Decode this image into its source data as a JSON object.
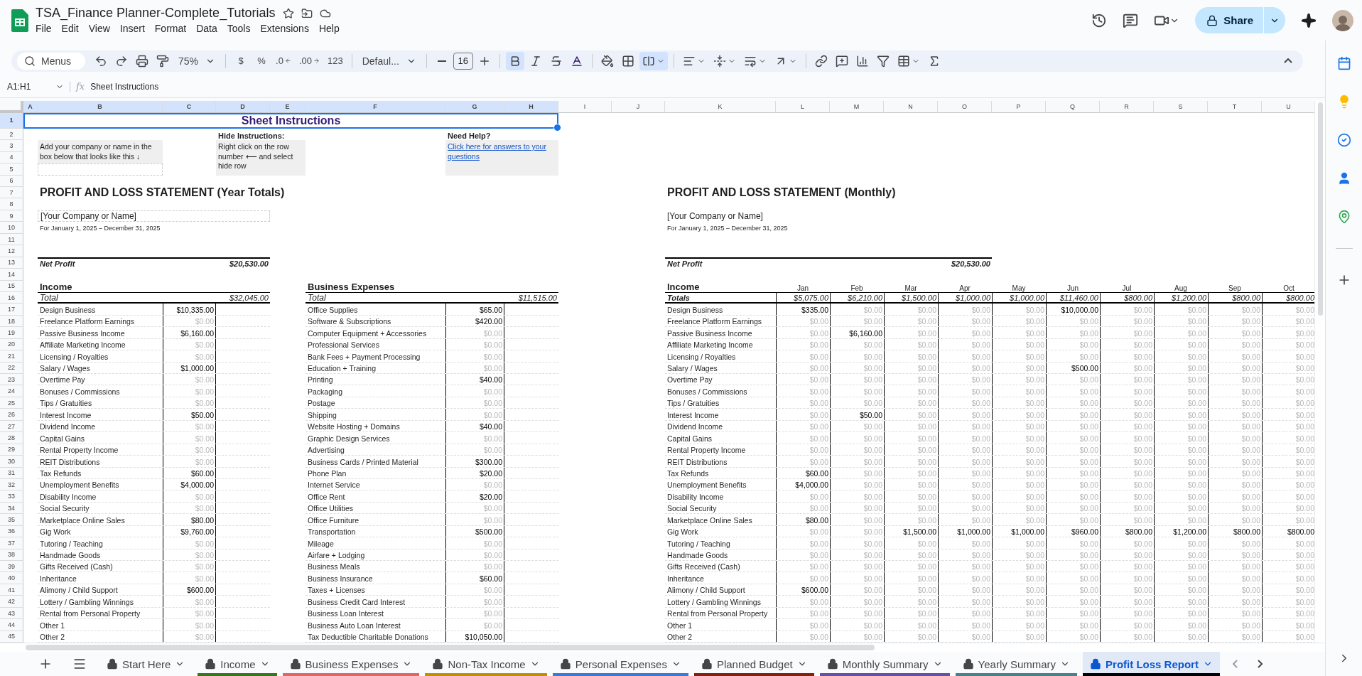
{
  "app": {
    "title": "TSA_Finance Planner-Complete_Tutorials",
    "menus": [
      "File",
      "Edit",
      "View",
      "Insert",
      "Format",
      "Data",
      "Tools",
      "Extensions",
      "Help"
    ],
    "share": "Share"
  },
  "toolbar": {
    "search_placeholder": "Menus",
    "zoom": "75%",
    "currency": "$",
    "percent": "%",
    "decrease_decimals": ".0",
    "increase_decimals": ".00",
    "number_format": "123",
    "font": "Defaul...",
    "font_size": "16",
    "bold": true,
    "merge": true
  },
  "formula_bar": {
    "cell": "A1:H1",
    "fx": "fx",
    "content": "Sheet Instructions"
  },
  "column_headers": [
    {
      "label": "A",
      "selected": true
    },
    {
      "label": "B",
      "selected": true
    },
    {
      "label": "C",
      "selected": true
    },
    {
      "label": "D",
      "selected": true
    },
    {
      "label": "E",
      "selected": true
    },
    {
      "label": "F",
      "selected": true
    },
    {
      "label": "G",
      "selected": true
    },
    {
      "label": "H",
      "selected": true
    },
    {
      "label": "I",
      "selected": false
    },
    {
      "label": "J",
      "selected": false
    },
    {
      "label": "K",
      "selected": false
    },
    {
      "label": "L",
      "selected": false
    },
    {
      "label": "M",
      "selected": false
    },
    {
      "label": "N",
      "selected": false
    },
    {
      "label": "O",
      "selected": false
    },
    {
      "label": "P",
      "selected": false
    },
    {
      "label": "Q",
      "selected": false
    },
    {
      "label": "R",
      "selected": false
    },
    {
      "label": "S",
      "selected": false
    },
    {
      "label": "T",
      "selected": false
    },
    {
      "label": "U",
      "selected": false
    }
  ],
  "row_headers": [
    {
      "label": "1",
      "selected": true
    },
    {
      "label": "2",
      "selected": false
    },
    {
      "label": "3",
      "selected": false
    },
    {
      "label": "4",
      "selected": false
    },
    {
      "label": "5",
      "selected": false
    },
    {
      "label": "6",
      "selected": false
    },
    {
      "label": "7",
      "selected": false
    },
    {
      "label": "8",
      "selected": false
    },
    {
      "label": "9",
      "selected": false
    },
    {
      "label": "10",
      "selected": false
    },
    {
      "label": "11",
      "selected": false
    },
    {
      "label": "12",
      "selected": false
    },
    {
      "label": "13",
      "selected": false
    },
    {
      "label": "14",
      "selected": false
    },
    {
      "label": "15",
      "selected": false
    },
    {
      "label": "16",
      "selected": false
    },
    {
      "label": "17",
      "selected": false
    },
    {
      "label": "18",
      "selected": false
    },
    {
      "label": "19",
      "selected": false
    },
    {
      "label": "20",
      "selected": false
    },
    {
      "label": "21",
      "selected": false
    },
    {
      "label": "22",
      "selected": false
    },
    {
      "label": "23",
      "selected": false
    },
    {
      "label": "24",
      "selected": false
    },
    {
      "label": "25",
      "selected": false
    },
    {
      "label": "26",
      "selected": false
    },
    {
      "label": "27",
      "selected": false
    },
    {
      "label": "28",
      "selected": false
    },
    {
      "label": "29",
      "selected": false
    },
    {
      "label": "30",
      "selected": false
    },
    {
      "label": "31",
      "selected": false
    },
    {
      "label": "32",
      "selected": false
    },
    {
      "label": "33",
      "selected": false
    },
    {
      "label": "34",
      "selected": false
    },
    {
      "label": "35",
      "selected": false
    },
    {
      "label": "36",
      "selected": false
    },
    {
      "label": "37",
      "selected": false
    },
    {
      "label": "38",
      "selected": false
    },
    {
      "label": "39",
      "selected": false
    },
    {
      "label": "40",
      "selected": false
    },
    {
      "label": "41",
      "selected": false
    },
    {
      "label": "42",
      "selected": false
    },
    {
      "label": "43",
      "selected": false
    },
    {
      "label": "44",
      "selected": false
    },
    {
      "label": "45",
      "selected": false
    }
  ],
  "instructions": {
    "title": "Sheet Instructions",
    "hide_heading": "Hide Instructions:",
    "help_heading": "Need Help?",
    "company_hint": "Add your company or name in the box below that looks like this ↓",
    "hide_text": "Right click on the row number ⟵ and select hide row",
    "help_link": "Click here for answers to your questions"
  },
  "year_totals": {
    "title": "PROFIT AND LOSS STATEMENT (Year Totals)",
    "company": "[Your Company or Name]",
    "period": "For January 1, 2025 – December 31, 2025",
    "net_profit_label": "Net Profit",
    "net_profit": "$20,530.00",
    "income": {
      "heading": "Income",
      "total_label": "Total",
      "total": "$32,045.00",
      "rows": [
        {
          "label": "Design Business",
          "value": "$10,335.00",
          "dim": false
        },
        {
          "label": "Freelance Platform Earnings",
          "value": "$0.00",
          "dim": true
        },
        {
          "label": "Passive Business Income",
          "value": "$6,160.00",
          "dim": false
        },
        {
          "label": "Affiliate Marketing Income",
          "value": "$0.00",
          "dim": true
        },
        {
          "label": "Licensing / Royalties",
          "value": "$0.00",
          "dim": true
        },
        {
          "label": "Salary / Wages",
          "value": "$1,000.00",
          "dim": false
        },
        {
          "label": "Overtime Pay",
          "value": "$0.00",
          "dim": true
        },
        {
          "label": "Bonuses / Commissions",
          "value": "$0.00",
          "dim": true
        },
        {
          "label": "Tips / Gratuities",
          "value": "$0.00",
          "dim": true
        },
        {
          "label": "Interest Income",
          "value": "$50.00",
          "dim": false
        },
        {
          "label": "Dividend Income",
          "value": "$0.00",
          "dim": true
        },
        {
          "label": "Capital Gains",
          "value": "$0.00",
          "dim": true
        },
        {
          "label": "Rental Property Income",
          "value": "$0.00",
          "dim": true
        },
        {
          "label": "REIT Distributions",
          "value": "$0.00",
          "dim": true
        },
        {
          "label": "Tax Refunds",
          "value": "$60.00",
          "dim": false
        },
        {
          "label": "Unemployment Benefits",
          "value": "$4,000.00",
          "dim": false
        },
        {
          "label": "Disability Income",
          "value": "$0.00",
          "dim": true
        },
        {
          "label": "Social Security",
          "value": "$0.00",
          "dim": true
        },
        {
          "label": "Marketplace Online Sales",
          "value": "$80.00",
          "dim": false
        },
        {
          "label": "Gig Work",
          "value": "$9,760.00",
          "dim": false
        },
        {
          "label": "Tutoring / Teaching",
          "value": "$0.00",
          "dim": true
        },
        {
          "label": "Handmade Goods",
          "value": "$0.00",
          "dim": true
        },
        {
          "label": "Gifts Received (Cash)",
          "value": "$0.00",
          "dim": true
        },
        {
          "label": "Inheritance",
          "value": "$0.00",
          "dim": true
        },
        {
          "label": "Alimony / Child Support",
          "value": "$600.00",
          "dim": false
        },
        {
          "label": "Lottery / Gambling Winnings",
          "value": "$0.00",
          "dim": true
        },
        {
          "label": "Rental from Personal Property",
          "value": "$0.00",
          "dim": true
        },
        {
          "label": "Other 1",
          "value": "$0.00",
          "dim": true
        },
        {
          "label": "Other 2",
          "value": "$0.00",
          "dim": true
        }
      ]
    },
    "expenses": {
      "heading": "Business Expenses",
      "total_label": "Total",
      "total": "$11,515.00",
      "rows": [
        {
          "label": "Office Supplies",
          "value": "$65.00",
          "dim": false
        },
        {
          "label": "Software & Subscriptions",
          "value": "$420.00",
          "dim": false
        },
        {
          "label": "Computer Equipment + Accessories",
          "value": "$0.00",
          "dim": true
        },
        {
          "label": "Professional Services",
          "value": "$0.00",
          "dim": true
        },
        {
          "label": "Bank Fees + Payment Processing",
          "value": "$0.00",
          "dim": true
        },
        {
          "label": "Education + Training",
          "value": "$0.00",
          "dim": true
        },
        {
          "label": "Printing",
          "value": "$40.00",
          "dim": false
        },
        {
          "label": "Packaging",
          "value": "$0.00",
          "dim": true
        },
        {
          "label": "Postage",
          "value": "$0.00",
          "dim": true
        },
        {
          "label": "Shipping",
          "value": "$0.00",
          "dim": true
        },
        {
          "label": "Website Hosting + Domains",
          "value": "$40.00",
          "dim": false
        },
        {
          "label": "Graphic Design Services",
          "value": "$0.00",
          "dim": true
        },
        {
          "label": "Advertising",
          "value": "$0.00",
          "dim": true
        },
        {
          "label": "Business Cards / Printed Material",
          "value": "$300.00",
          "dim": false
        },
        {
          "label": "Phone Plan",
          "value": "$20.00",
          "dim": false
        },
        {
          "label": "Internet Service",
          "value": "$0.00",
          "dim": true
        },
        {
          "label": "Office Rent",
          "value": "$20.00",
          "dim": false
        },
        {
          "label": "Office Utilities",
          "value": "$0.00",
          "dim": true
        },
        {
          "label": "Office Furniture",
          "value": "$0.00",
          "dim": true
        },
        {
          "label": "Transportation",
          "value": "$500.00",
          "dim": false
        },
        {
          "label": "Mileage",
          "value": "$0.00",
          "dim": true
        },
        {
          "label": "Airfare + Lodging",
          "value": "$0.00",
          "dim": true
        },
        {
          "label": "Business Meals",
          "value": "$0.00",
          "dim": true
        },
        {
          "label": "Business Insurance",
          "value": "$60.00",
          "dim": false
        },
        {
          "label": "Taxes + Licenses",
          "value": "$0.00",
          "dim": true
        },
        {
          "label": "Business Credit Card Interest",
          "value": "$0.00",
          "dim": true
        },
        {
          "label": "Business Loan Interest",
          "value": "$0.00",
          "dim": true
        },
        {
          "label": "Business Auto Loan Interest",
          "value": "$0.00",
          "dim": true
        },
        {
          "label": "Tax Deductible Charitable Donations",
          "value": "$10,050.00",
          "dim": false
        }
      ]
    }
  },
  "monthly": {
    "title": "PROFIT AND LOSS STATEMENT (Monthly)",
    "company": "[Your Company or Name]",
    "period": "For January 1, 2025 – December 31, 2025",
    "net_profit_label": "Net Profit",
    "net_profit": "$20,530.00",
    "heading": "Income",
    "months": [
      "Jan",
      "Feb",
      "Mar",
      "Apr",
      "May",
      "Jun",
      "Jul",
      "Aug",
      "Sep",
      "Oct"
    ],
    "totals_label": "Totals",
    "totals": [
      "$5,075.00",
      "$6,210.00",
      "$1,500.00",
      "$1,000.00",
      "$1,000.00",
      "$11,460.00",
      "$800.00",
      "$1,200.00",
      "$800.00",
      "$800.00"
    ],
    "rows": [
      {
        "label": "Design Business",
        "values": [
          "$335.00",
          "$0.00",
          "$0.00",
          "$0.00",
          "$0.00",
          "$10,000.00",
          "$0.00",
          "$0.00",
          "$0.00",
          "$0.00"
        ],
        "dim": [
          false,
          true,
          true,
          true,
          true,
          false,
          true,
          true,
          true,
          true
        ]
      },
      {
        "label": "Freelance Platform Earnings",
        "values": [
          "$0.00",
          "$0.00",
          "$0.00",
          "$0.00",
          "$0.00",
          "$0.00",
          "$0.00",
          "$0.00",
          "$0.00",
          "$0.00"
        ],
        "dim": [
          true,
          true,
          true,
          true,
          true,
          true,
          true,
          true,
          true,
          true
        ]
      },
      {
        "label": "Passive Business Income",
        "values": [
          "$0.00",
          "$6,160.00",
          "$0.00",
          "$0.00",
          "$0.00",
          "$0.00",
          "$0.00",
          "$0.00",
          "$0.00",
          "$0.00"
        ],
        "dim": [
          true,
          false,
          true,
          true,
          true,
          true,
          true,
          true,
          true,
          true
        ]
      },
      {
        "label": "Affiliate Marketing Income",
        "values": [
          "$0.00",
          "$0.00",
          "$0.00",
          "$0.00",
          "$0.00",
          "$0.00",
          "$0.00",
          "$0.00",
          "$0.00",
          "$0.00"
        ],
        "dim": [
          true,
          true,
          true,
          true,
          true,
          true,
          true,
          true,
          true,
          true
        ]
      },
      {
        "label": "Licensing / Royalties",
        "values": [
          "$0.00",
          "$0.00",
          "$0.00",
          "$0.00",
          "$0.00",
          "$0.00",
          "$0.00",
          "$0.00",
          "$0.00",
          "$0.00"
        ],
        "dim": [
          true,
          true,
          true,
          true,
          true,
          true,
          true,
          true,
          true,
          true
        ]
      },
      {
        "label": "Salary / Wages",
        "values": [
          "$0.00",
          "$0.00",
          "$0.00",
          "$0.00",
          "$0.00",
          "$500.00",
          "$0.00",
          "$0.00",
          "$0.00",
          "$0.00"
        ],
        "dim": [
          true,
          true,
          true,
          true,
          true,
          false,
          true,
          true,
          true,
          true
        ]
      },
      {
        "label": "Overtime Pay",
        "values": [
          "$0.00",
          "$0.00",
          "$0.00",
          "$0.00",
          "$0.00",
          "$0.00",
          "$0.00",
          "$0.00",
          "$0.00",
          "$0.00"
        ],
        "dim": [
          true,
          true,
          true,
          true,
          true,
          true,
          true,
          true,
          true,
          true
        ]
      },
      {
        "label": "Bonuses / Commissions",
        "values": [
          "$0.00",
          "$0.00",
          "$0.00",
          "$0.00",
          "$0.00",
          "$0.00",
          "$0.00",
          "$0.00",
          "$0.00",
          "$0.00"
        ],
        "dim": [
          true,
          true,
          true,
          true,
          true,
          true,
          true,
          true,
          true,
          true
        ]
      },
      {
        "label": "Tips / Gratuities",
        "values": [
          "$0.00",
          "$0.00",
          "$0.00",
          "$0.00",
          "$0.00",
          "$0.00",
          "$0.00",
          "$0.00",
          "$0.00",
          "$0.00"
        ],
        "dim": [
          true,
          true,
          true,
          true,
          true,
          true,
          true,
          true,
          true,
          true
        ]
      },
      {
        "label": "Interest Income",
        "values": [
          "$0.00",
          "$50.00",
          "$0.00",
          "$0.00",
          "$0.00",
          "$0.00",
          "$0.00",
          "$0.00",
          "$0.00",
          "$0.00"
        ],
        "dim": [
          true,
          false,
          true,
          true,
          true,
          true,
          true,
          true,
          true,
          true
        ]
      },
      {
        "label": "Dividend Income",
        "values": [
          "$0.00",
          "$0.00",
          "$0.00",
          "$0.00",
          "$0.00",
          "$0.00",
          "$0.00",
          "$0.00",
          "$0.00",
          "$0.00"
        ],
        "dim": [
          true,
          true,
          true,
          true,
          true,
          true,
          true,
          true,
          true,
          true
        ]
      },
      {
        "label": "Capital Gains",
        "values": [
          "$0.00",
          "$0.00",
          "$0.00",
          "$0.00",
          "$0.00",
          "$0.00",
          "$0.00",
          "$0.00",
          "$0.00",
          "$0.00"
        ],
        "dim": [
          true,
          true,
          true,
          true,
          true,
          true,
          true,
          true,
          true,
          true
        ]
      },
      {
        "label": "Rental Property Income",
        "values": [
          "$0.00",
          "$0.00",
          "$0.00",
          "$0.00",
          "$0.00",
          "$0.00",
          "$0.00",
          "$0.00",
          "$0.00",
          "$0.00"
        ],
        "dim": [
          true,
          true,
          true,
          true,
          true,
          true,
          true,
          true,
          true,
          true
        ]
      },
      {
        "label": "REIT Distributions",
        "values": [
          "$0.00",
          "$0.00",
          "$0.00",
          "$0.00",
          "$0.00",
          "$0.00",
          "$0.00",
          "$0.00",
          "$0.00",
          "$0.00"
        ],
        "dim": [
          true,
          true,
          true,
          true,
          true,
          true,
          true,
          true,
          true,
          true
        ]
      },
      {
        "label": "Tax Refunds",
        "values": [
          "$60.00",
          "$0.00",
          "$0.00",
          "$0.00",
          "$0.00",
          "$0.00",
          "$0.00",
          "$0.00",
          "$0.00",
          "$0.00"
        ],
        "dim": [
          false,
          true,
          true,
          true,
          true,
          true,
          true,
          true,
          true,
          true
        ]
      },
      {
        "label": "Unemployment Benefits",
        "values": [
          "$4,000.00",
          "$0.00",
          "$0.00",
          "$0.00",
          "$0.00",
          "$0.00",
          "$0.00",
          "$0.00",
          "$0.00",
          "$0.00"
        ],
        "dim": [
          false,
          true,
          true,
          true,
          true,
          true,
          true,
          true,
          true,
          true
        ]
      },
      {
        "label": "Disability Income",
        "values": [
          "$0.00",
          "$0.00",
          "$0.00",
          "$0.00",
          "$0.00",
          "$0.00",
          "$0.00",
          "$0.00",
          "$0.00",
          "$0.00"
        ],
        "dim": [
          true,
          true,
          true,
          true,
          true,
          true,
          true,
          true,
          true,
          true
        ]
      },
      {
        "label": "Social Security",
        "values": [
          "$0.00",
          "$0.00",
          "$0.00",
          "$0.00",
          "$0.00",
          "$0.00",
          "$0.00",
          "$0.00",
          "$0.00",
          "$0.00"
        ],
        "dim": [
          true,
          true,
          true,
          true,
          true,
          true,
          true,
          true,
          true,
          true
        ]
      },
      {
        "label": "Marketplace Online Sales",
        "values": [
          "$80.00",
          "$0.00",
          "$0.00",
          "$0.00",
          "$0.00",
          "$0.00",
          "$0.00",
          "$0.00",
          "$0.00",
          "$0.00"
        ],
        "dim": [
          false,
          true,
          true,
          true,
          true,
          true,
          true,
          true,
          true,
          true
        ]
      },
      {
        "label": "Gig Work",
        "values": [
          "$0.00",
          "$0.00",
          "$1,500.00",
          "$1,000.00",
          "$1,000.00",
          "$960.00",
          "$800.00",
          "$1,200.00",
          "$800.00",
          "$800.00"
        ],
        "dim": [
          true,
          true,
          false,
          false,
          false,
          false,
          false,
          false,
          false,
          false
        ]
      },
      {
        "label": "Tutoring / Teaching",
        "values": [
          "$0.00",
          "$0.00",
          "$0.00",
          "$0.00",
          "$0.00",
          "$0.00",
          "$0.00",
          "$0.00",
          "$0.00",
          "$0.00"
        ],
        "dim": [
          true,
          true,
          true,
          true,
          true,
          true,
          true,
          true,
          true,
          true
        ]
      },
      {
        "label": "Handmade Goods",
        "values": [
          "$0.00",
          "$0.00",
          "$0.00",
          "$0.00",
          "$0.00",
          "$0.00",
          "$0.00",
          "$0.00",
          "$0.00",
          "$0.00"
        ],
        "dim": [
          true,
          true,
          true,
          true,
          true,
          true,
          true,
          true,
          true,
          true
        ]
      },
      {
        "label": "Gifts Received (Cash)",
        "values": [
          "$0.00",
          "$0.00",
          "$0.00",
          "$0.00",
          "$0.00",
          "$0.00",
          "$0.00",
          "$0.00",
          "$0.00",
          "$0.00"
        ],
        "dim": [
          true,
          true,
          true,
          true,
          true,
          true,
          true,
          true,
          true,
          true
        ]
      },
      {
        "label": "Inheritance",
        "values": [
          "$0.00",
          "$0.00",
          "$0.00",
          "$0.00",
          "$0.00",
          "$0.00",
          "$0.00",
          "$0.00",
          "$0.00",
          "$0.00"
        ],
        "dim": [
          true,
          true,
          true,
          true,
          true,
          true,
          true,
          true,
          true,
          true
        ]
      },
      {
        "label": "Alimony / Child Support",
        "values": [
          "$600.00",
          "$0.00",
          "$0.00",
          "$0.00",
          "$0.00",
          "$0.00",
          "$0.00",
          "$0.00",
          "$0.00",
          "$0.00"
        ],
        "dim": [
          false,
          true,
          true,
          true,
          true,
          true,
          true,
          true,
          true,
          true
        ]
      },
      {
        "label": "Lottery / Gambling Winnings",
        "values": [
          "$0.00",
          "$0.00",
          "$0.00",
          "$0.00",
          "$0.00",
          "$0.00",
          "$0.00",
          "$0.00",
          "$0.00",
          "$0.00"
        ],
        "dim": [
          true,
          true,
          true,
          true,
          true,
          true,
          true,
          true,
          true,
          true
        ]
      },
      {
        "label": "Rental from Personal Property",
        "values": [
          "$0.00",
          "$0.00",
          "$0.00",
          "$0.00",
          "$0.00",
          "$0.00",
          "$0.00",
          "$0.00",
          "$0.00",
          "$0.00"
        ],
        "dim": [
          true,
          true,
          true,
          true,
          true,
          true,
          true,
          true,
          true,
          true
        ]
      },
      {
        "label": "Other 1",
        "values": [
          "$0.00",
          "$0.00",
          "$0.00",
          "$0.00",
          "$0.00",
          "$0.00",
          "$0.00",
          "$0.00",
          "$0.00",
          "$0.00"
        ],
        "dim": [
          true,
          true,
          true,
          true,
          true,
          true,
          true,
          true,
          true,
          true
        ]
      },
      {
        "label": "Other 2",
        "values": [
          "$0.00",
          "$0.00",
          "$0.00",
          "$0.00",
          "$0.00",
          "$0.00",
          "$0.00",
          "$0.00",
          "$0.00",
          "$0.00"
        ],
        "dim": [
          true,
          true,
          true,
          true,
          true,
          true,
          true,
          true,
          true,
          true
        ]
      }
    ]
  },
  "sheet_tabs": [
    {
      "label": "Start Here",
      "selected": false
    },
    {
      "label": "Income",
      "selected": false,
      "color": "#38761d"
    },
    {
      "label": "Business Expenses",
      "selected": false,
      "color": "#e06666"
    },
    {
      "label": "Non-Tax Income",
      "selected": false,
      "color": "#bf9000"
    },
    {
      "label": "Personal Expenses",
      "selected": false,
      "color": "#3c78d8"
    },
    {
      "label": "Planned Budget",
      "selected": false,
      "color": "#85200c"
    },
    {
      "label": "Monthly Summary",
      "selected": false,
      "color": "#674ea7"
    },
    {
      "label": "Yearly Summary",
      "selected": false,
      "color": "#45818e"
    },
    {
      "label": "Profit Loss Report",
      "selected": true,
      "color": "#000000"
    }
  ]
}
